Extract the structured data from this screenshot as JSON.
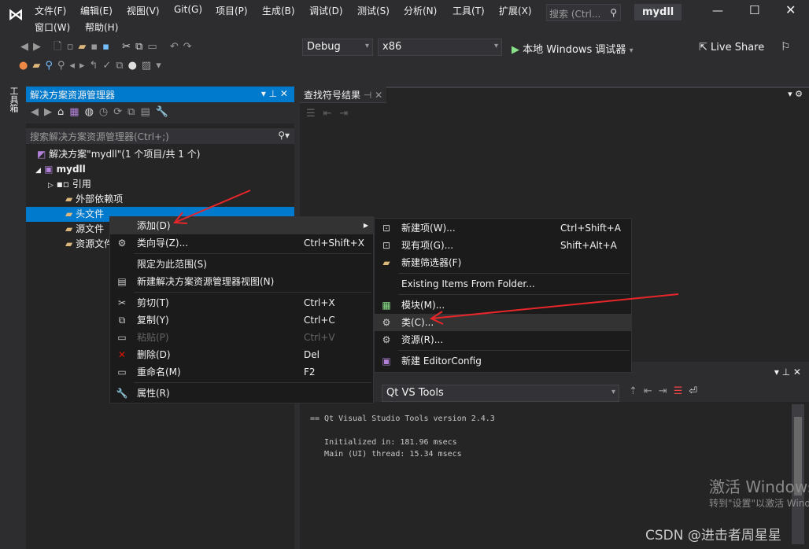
{
  "app": {
    "title": "mydll",
    "search_placeholder": "搜索 (Ctrl...",
    "colors": {
      "accent": "#007acc",
      "background": "#2d2d30",
      "menu": "#1b1b1c",
      "arrow": "#e8262a"
    }
  },
  "menu": [
    "文件(F)",
    "编辑(E)",
    "视图(V)",
    "Git(G)",
    "项目(P)",
    "生成(B)",
    "调试(D)",
    "测试(S)",
    "分析(N)",
    "工具(T)",
    "扩展(X)",
    "窗口(W)",
    "帮助(H)"
  ],
  "toolbar": {
    "config": "Debug",
    "platform": "x86",
    "run_label": "本地 Windows 调试器",
    "live_share": "Live Share"
  },
  "toolbox_label": "工具箱",
  "solution_explorer": {
    "title": "解决方案资源管理器",
    "search_placeholder": "搜索解决方案资源管理器(Ctrl+;)",
    "tree": [
      "解决方案\"mydll\"(1 个项目/共 1 个)",
      "mydll",
      "引用",
      "外部依赖项",
      "头文件",
      "源文件",
      "资源文件"
    ]
  },
  "find_symbol": {
    "tab": "查找符号结果"
  },
  "context_menu": [
    {
      "label": "添加(D)",
      "shortcut": "",
      "icon": ""
    },
    {
      "label": "类向导(Z)...",
      "shortcut": "Ctrl+Shift+X",
      "icon": "class-wizard-icon"
    },
    {
      "label": "限定为此范围(S)",
      "shortcut": "",
      "icon": ""
    },
    {
      "label": "新建解决方案资源管理器视图(N)",
      "shortcut": "",
      "icon": "new-view-icon"
    },
    {
      "label": "剪切(T)",
      "shortcut": "Ctrl+X",
      "icon": "scissors-icon"
    },
    {
      "label": "复制(Y)",
      "shortcut": "Ctrl+C",
      "icon": "copy-icon"
    },
    {
      "label": "粘贴(P)",
      "shortcut": "Ctrl+V",
      "icon": "paste-icon"
    },
    {
      "label": "删除(D)",
      "shortcut": "Del",
      "icon": "delete-icon"
    },
    {
      "label": "重命名(M)",
      "shortcut": "F2",
      "icon": "rename-icon"
    },
    {
      "label": "属性(R)",
      "shortcut": "",
      "icon": "wrench-icon"
    }
  ],
  "submenu": [
    {
      "label": "新建项(W)...",
      "shortcut": "Ctrl+Shift+A"
    },
    {
      "label": "现有项(G)...",
      "shortcut": "Shift+Alt+A"
    },
    {
      "label": "新建筛选器(F)",
      "shortcut": ""
    },
    {
      "label": "Existing Items From Folder...",
      "shortcut": ""
    },
    {
      "label": "模块(M)...",
      "shortcut": ""
    },
    {
      "label": "类(C)...",
      "shortcut": ""
    },
    {
      "label": "资源(R)...",
      "shortcut": ""
    },
    {
      "label": "新建 EditorConfig",
      "shortcut": ""
    }
  ],
  "output": {
    "source": "Qt VS Tools",
    "lines": [
      "== Qt Visual Studio Tools version 2.4.3",
      "",
      "   Initialized in: 181.96 msecs",
      "   Main (UI) thread: 15.34 msecs"
    ]
  },
  "watermark": {
    "activate_title": "激活 Windows",
    "activate_sub": "转到\"设置\"以激活 Windows。",
    "csdn": "CSDN @进击者周星星"
  }
}
